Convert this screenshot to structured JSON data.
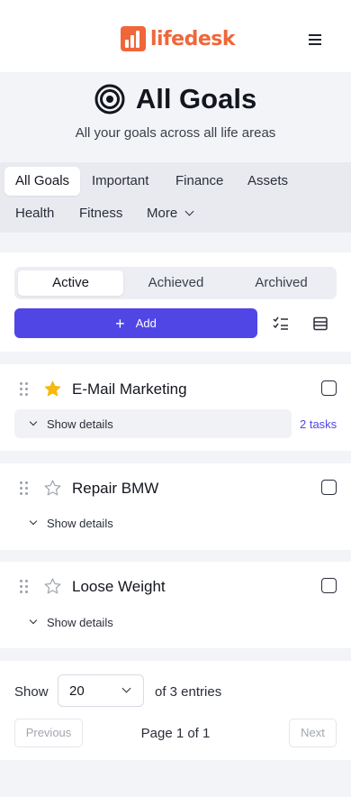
{
  "brand": {
    "name": "lifedesk",
    "color": "#f0663a"
  },
  "header": {
    "menu_icon": "hamburger-icon"
  },
  "page": {
    "title": "All Goals",
    "title_icon": "target-icon",
    "subtitle": "All your goals across all life areas"
  },
  "tabs": [
    {
      "label": "All Goals",
      "active": true
    },
    {
      "label": "Important",
      "active": false
    },
    {
      "label": "Finance",
      "active": false
    },
    {
      "label": "Assets",
      "active": false
    },
    {
      "label": "Health",
      "active": false
    },
    {
      "label": "Fitness",
      "active": false
    },
    {
      "label": "More",
      "active": false,
      "icon": "chevron-down-icon"
    }
  ],
  "status_filter": {
    "options": [
      "Active",
      "Achieved",
      "Archived"
    ],
    "selected": "Active"
  },
  "toolbar": {
    "add_label": "Add",
    "accent": "#5046e5",
    "icons": [
      "checklist-icon",
      "table-view-icon"
    ]
  },
  "goals": [
    {
      "title": "E-Mail Marketing",
      "starred": true,
      "details_label": "Show details",
      "tasks": "2 tasks",
      "completed": false
    },
    {
      "title": "Repair BMW",
      "starred": false,
      "details_label": "Show details",
      "tasks": "",
      "completed": false
    },
    {
      "title": "Loose Weight",
      "starred": false,
      "details_label": "Show details",
      "tasks": "",
      "completed": false
    }
  ],
  "pagination": {
    "show_label": "Show",
    "page_size": "20",
    "entries_label": "of 3 entries",
    "previous_label": "Previous",
    "page_info": "Page 1 of 1",
    "next_label": "Next"
  }
}
